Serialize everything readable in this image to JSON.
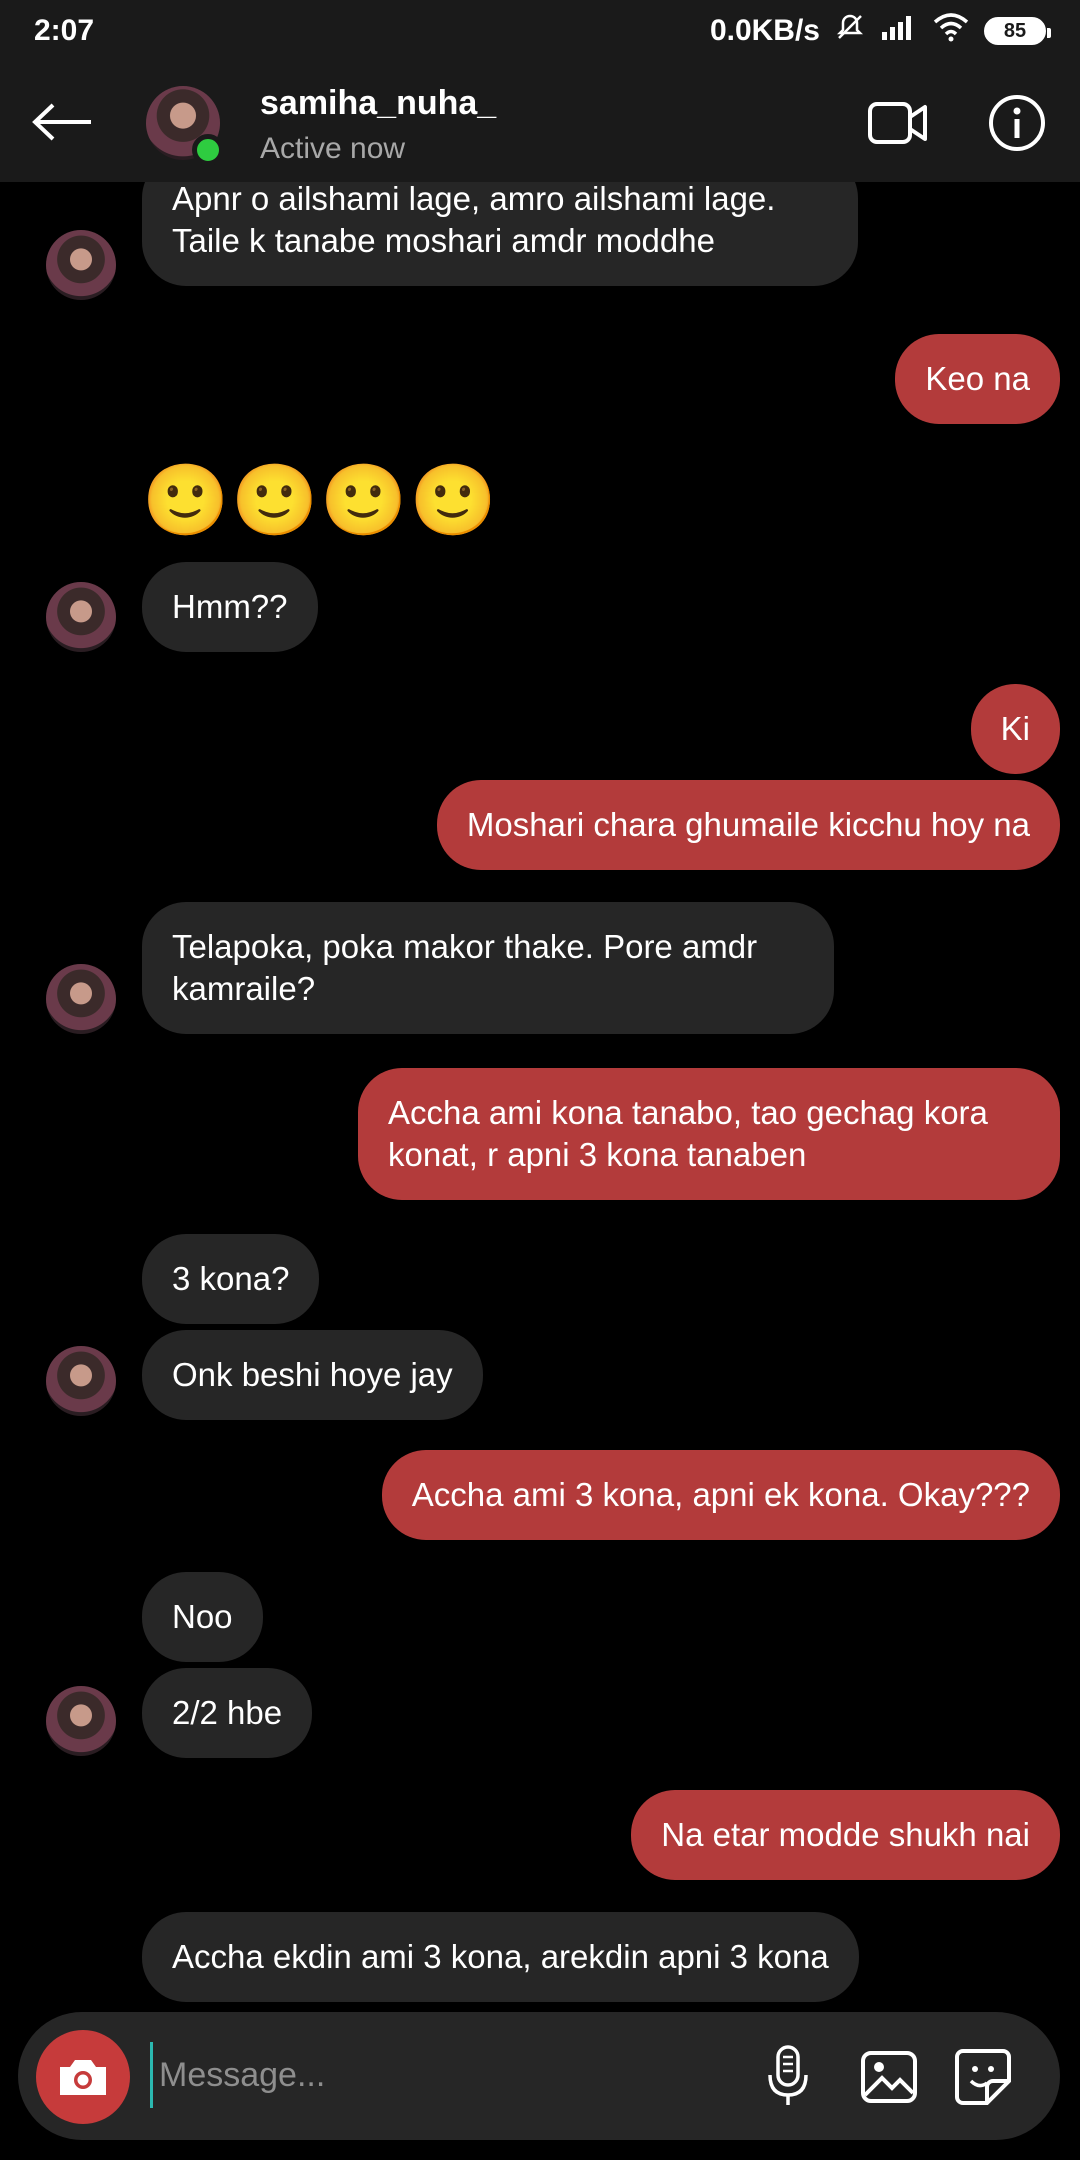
{
  "status_bar": {
    "time": "2:07",
    "network_speed": "0.0KB/s",
    "battery": "85"
  },
  "header": {
    "username": "samiha_nuha_",
    "status": "Active now"
  },
  "messages": [
    {
      "from": "them",
      "text": "Apnr o ailshami lage, amro ailshami lage.\nTaile k tanabe moshari amdr moddhe"
    },
    {
      "from": "me",
      "text": "Keo na"
    },
    {
      "from": "them",
      "text": "🙂🙂🙂🙂"
    },
    {
      "from": "them",
      "text": "Hmm??"
    },
    {
      "from": "me",
      "text": "Ki"
    },
    {
      "from": "me",
      "text": "Moshari chara ghumaile kicchu hoy na"
    },
    {
      "from": "them",
      "text": "Telapoka, poka makor thake. Pore amdr\nkamraile?"
    },
    {
      "from": "me",
      "text": "Accha ami kona tanabo, tao gechag kora\nkonat, r apni 3 kona tanaben"
    },
    {
      "from": "them",
      "text": "3 kona?"
    },
    {
      "from": "them",
      "text": "Onk beshi hoye jay"
    },
    {
      "from": "me",
      "text": "Accha ami 3 kona, apni ek kona. Okay???"
    },
    {
      "from": "them",
      "text": "Noo"
    },
    {
      "from": "them",
      "text": "2/2 hbe"
    },
    {
      "from": "me",
      "text": "Na etar modde shukh nai"
    },
    {
      "from": "them",
      "text": "Accha ekdin ami 3 kona, arekdin apni 3 kona"
    }
  ],
  "composer": {
    "placeholder": "Message..."
  },
  "colors": {
    "sent_bubble": "#b33b3b",
    "received_bubble": "#262626",
    "online": "#2ecc40",
    "camera": "#c63b3b"
  }
}
